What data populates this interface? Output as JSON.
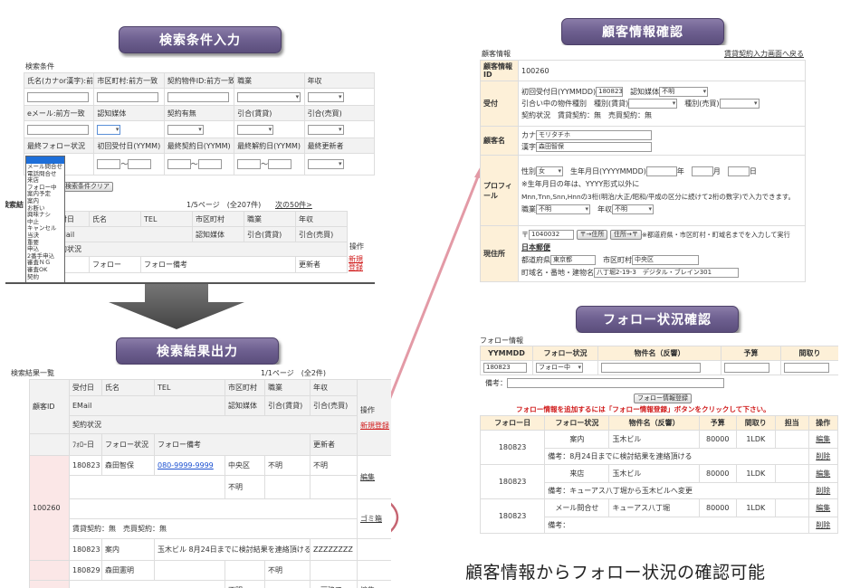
{
  "banners": {
    "search_input": "検索条件入力",
    "search_output": "検索結果出力",
    "customer_check": "顧客情報確認",
    "follow_check": "フォロー状況確認"
  },
  "caption": "顧客情報からフォロー状況の確認可能",
  "search_form": {
    "section_title": "検索条件",
    "row1_labels": [
      "氏名(カナor漢字):前方一致",
      "市区町村:前方一致",
      "契約物件ID:前方一致",
      "職業",
      "年収"
    ],
    "row2_labels": [
      "eメール:前方一致",
      "認知媒体",
      "契約有無",
      "引合(賃貸)",
      "引合(売買)"
    ],
    "row3_labels": [
      "最終フォロー状況",
      "初回受付日(YYMM)",
      "最終契約日(YYMM)",
      "最終解約日(YYMM)",
      "最終更新者"
    ],
    "range_sep": "～",
    "clear_button": "検索条件クリア",
    "dropdown_options": [
      "メール問合せ",
      "電話問合せ",
      "来店",
      "フォロー中",
      "案内予定",
      "案内",
      "お断い",
      "興味ナシ",
      "中止",
      "キャンセル",
      "当決",
      "重要",
      "申込",
      "2番手申込",
      "審査ＮＧ",
      "審査OK",
      "契約"
    ],
    "pager": "1/5ページ　(全207件)",
    "next_link": "次の50件>",
    "side_label": "検索結",
    "header_row1": [
      "付日",
      "氏名",
      "TEL",
      "市区町村",
      "職業",
      "年収"
    ],
    "header_row2": [
      "Mail",
      "認知媒体",
      "引合(賃貸)",
      "引合(売買)"
    ],
    "header_row3": "約状況",
    "operation": "操作",
    "new_register": "新規登録",
    "follow_label": "フォロー",
    "follow_remark": "フォロー備考",
    "updater": "更新者",
    "date_partial": "0-日"
  },
  "search_result": {
    "title": "検索結果一覧",
    "pager": "1/1ページ　(全2件)",
    "customer_id_label": "顧客ID",
    "headers_row1": [
      "受付日",
      "氏名",
      "TEL",
      "市区町村",
      "職業",
      "年収"
    ],
    "headers_row2": [
      "EMail",
      "認知媒体",
      "引合(賃貸)",
      "引合(売買)"
    ],
    "contract_status": "契約状況",
    "follow_headers": [
      "ﾌｫﾛｰ日",
      "フォロー状況",
      "フォロー備考",
      "更新者"
    ],
    "operation": "操作",
    "new_register": "新規登録",
    "customer_id": "100260",
    "rec1": {
      "date": "180823",
      "name": "森田智保",
      "tel": "080-9999-9999",
      "city": "中央区",
      "job": "不明",
      "income": "不明"
    },
    "unknown": "不明",
    "edit": "編集",
    "trash": "ゴミ箱",
    "contract_text": "賃貸契約：無　売買契約：無",
    "follow_row": {
      "date": "180823",
      "status": "案内",
      "remark": "玉木ビル 8月24日までに検討結果を連絡頂ける",
      "updater": "ZZZZZZZZ"
    },
    "rec2": {
      "date": "180829",
      "name": "森田憲明",
      "job": "不明",
      "job2": "不明",
      "income": "一戸建て"
    }
  },
  "customer_info": {
    "section_title": "顧客情報",
    "back_link": "賃貸契約入力画面へ戻る",
    "id_label": "顧客情報ID",
    "id_value": "100260",
    "reception_label": "受付",
    "first_date_label": "初回受付日(YYMMDD)",
    "first_date_value": "180823",
    "media_label": "認知媒体",
    "media_value": "不明",
    "inquiry_label": "引合い中の物件種別　種別(賃貸)",
    "sale_label": "種別(売買)",
    "contract_status": "契約状況　賃貸契約：無　売買契約：無",
    "name_label": "顧客名",
    "kana_label": "カナ",
    "kana_value": "モリタチホ",
    "kanji_label": "漢字",
    "kanji_value": "森田智保",
    "profile_label": "プロフィール",
    "sex_label": "性別",
    "sex_value": "女",
    "birth_label": "生年月日(YYYYMMDD)",
    "year_suffix": "年",
    "month_suffix": "月",
    "day_suffix": "日",
    "note1": "※生年月日の年は、YYYY形式以外に",
    "note2": "Mnn,Tnn,Snn,Hnnの3桁(明治/大正/昭和/平成の区分に続けて2桁の数字)で入力できます。",
    "job_label": "職業",
    "job_value": "不明",
    "income_label": "年収",
    "income_value": "不明",
    "address_label": "現住所",
    "postal_prefix": "〒",
    "postal_value": "1040032",
    "to_address_btn": "〒→住所",
    "address_to_btn": "住所→〒",
    "address_note": "※都道府県・市区町村・町域名までを入力して実行",
    "japan_post": "日本郵便",
    "pref_label": "都道府県",
    "pref_value": "東京都",
    "city_label": "市区町村",
    "city_value": "中央区",
    "street_label": "町域名・番地・建物名",
    "street_value": "八丁堀2-19-3　デジタル・ブレイン301"
  },
  "follow_info": {
    "section_title": "フォロー情報",
    "form_headers": [
      "YYMMDD",
      "フォロー状況",
      "物件名（反響）",
      "予算",
      "間取り"
    ],
    "date_value": "180823",
    "status_value": "フォロー中",
    "memo_label": "備考：",
    "register_button": "フォロー情報登録",
    "notice": "フォロー情報を追加するには「フォロー情報登録」ボタンをクリックして下さい。",
    "list_headers": [
      "フォロー日",
      "フォロー状況",
      "物件名（反響）",
      "予算",
      "間取り",
      "担当",
      "操作"
    ],
    "edit": "編集",
    "delete": "削除",
    "rows": [
      {
        "date": "180823",
        "status": "案内",
        "property": "玉木ビル",
        "budget": "80000",
        "layout": "1LDK",
        "memo": "備考：8月24日までに検討結果を連絡頂ける"
      },
      {
        "date": "180823",
        "status": "来店",
        "property": "玉木ビル",
        "budget": "80000",
        "layout": "1LDK",
        "memo": "備考：キューアス八丁堀から玉木ビルへ変更"
      },
      {
        "date": "180823",
        "status": "メール問合せ",
        "property": "キューアス八丁堀",
        "budget": "80000",
        "layout": "1LDK",
        "memo": "備考："
      }
    ]
  }
}
